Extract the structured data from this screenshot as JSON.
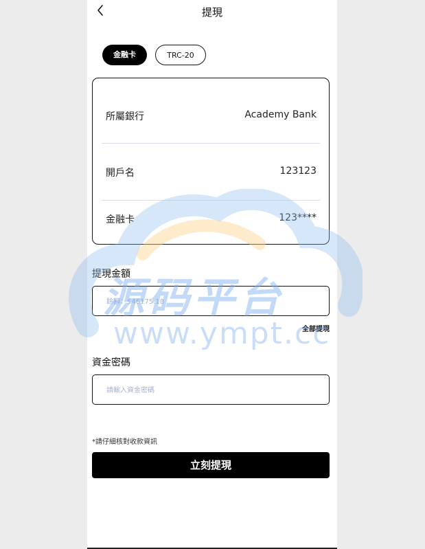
{
  "nav": {
    "title": "提現"
  },
  "tabs": [
    {
      "label": "金融卡",
      "active": true
    },
    {
      "label": "TRC-20",
      "active": false
    }
  ],
  "card": {
    "rows": [
      {
        "label": "所屬銀行",
        "value": "Academy Bank"
      },
      {
        "label": "開戶名",
        "value": "123123"
      },
      {
        "label": "金融卡",
        "value": "123****"
      }
    ]
  },
  "amount": {
    "title": "提現金額",
    "placeholder": "餘額：$46175.18",
    "all_label": "全部提現"
  },
  "password": {
    "title": "資金密碼",
    "placeholder": "請輸入資金密碼"
  },
  "note": "*請仔細核對收款資訊",
  "submit_label": "立刻提現",
  "watermark": {
    "text": "源码平台",
    "url": "www.ympt.cc"
  },
  "colors": {
    "primary": "#000000",
    "placeholder": "#aab0d4",
    "divider": "#dadbe6"
  }
}
